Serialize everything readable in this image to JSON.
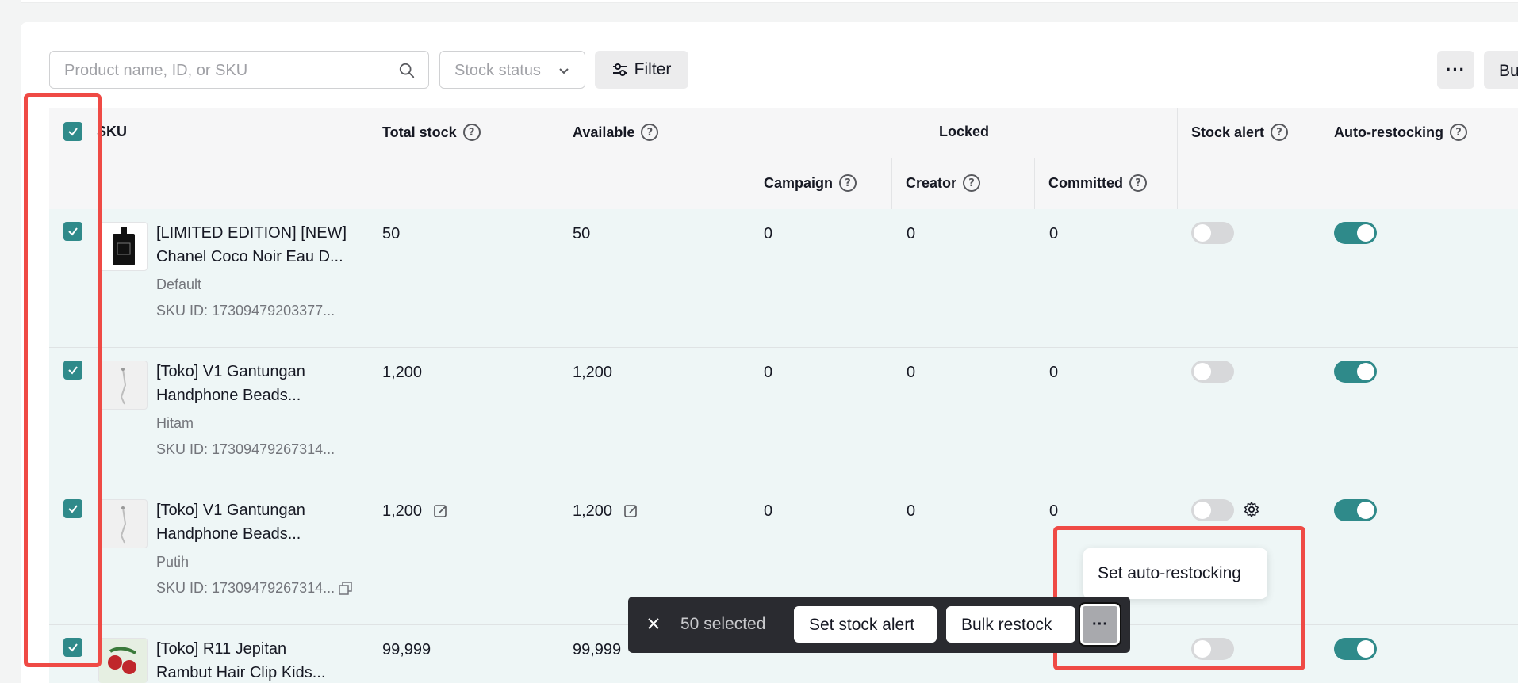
{
  "toolbar": {
    "search_placeholder": "Product name, ID, or SKU",
    "stock_status_placeholder": "Stock status",
    "filter_label": "Filter",
    "more_label": "···",
    "bulk_label": "Bu"
  },
  "columns": {
    "sku": "SKU",
    "total_stock": "Total stock",
    "available": "Available",
    "locked": "Locked",
    "campaign": "Campaign",
    "creator": "Creator",
    "committed": "Committed",
    "stock_alert": "Stock alert",
    "auto_restocking": "Auto-restocking"
  },
  "rows": [
    {
      "name_line1": "[LIMITED EDITION] [NEW]",
      "name_line2": "Chanel Coco Noir Eau D...",
      "variant": "Default",
      "sku_id": "SKU ID: 17309479203377...",
      "total_stock": "50",
      "available": "50",
      "campaign": "0",
      "creator": "0",
      "committed": "0",
      "stock_alert": false,
      "auto_restocking": true
    },
    {
      "name_line1": "[Toko] V1 Gantungan",
      "name_line2": "Handphone Beads...",
      "variant": "Hitam",
      "sku_id": "SKU ID: 17309479267314...",
      "total_stock": "1,200",
      "available": "1,200",
      "campaign": "0",
      "creator": "0",
      "committed": "0",
      "stock_alert": false,
      "auto_restocking": true
    },
    {
      "name_line1": "[Toko] V1 Gantungan",
      "name_line2": "Handphone Beads...",
      "variant": "Putih",
      "sku_id": "SKU ID: 17309479267314...",
      "total_stock": "1,200",
      "available": "1,200",
      "campaign": "0",
      "creator": "0",
      "committed": "0",
      "stock_alert": false,
      "auto_restocking": true
    },
    {
      "name_line1": "[Toko] R11 Jepitan",
      "name_line2": "Rambut Hair Clip Kids...",
      "total_stock": "99,999",
      "available": "99,999",
      "stock_alert": false,
      "auto_restocking": true
    }
  ],
  "bulk_bar": {
    "selected_text": "50 selected",
    "set_stock_alert": "Set stock alert",
    "bulk_restock": "Bulk restock",
    "more_label": "···"
  },
  "popover": {
    "set_auto_restocking": "Set auto-restocking"
  },
  "colors": {
    "accent": "#2f8a8a",
    "highlight": "#ef4a45",
    "row_bg": "#eef6f6"
  }
}
